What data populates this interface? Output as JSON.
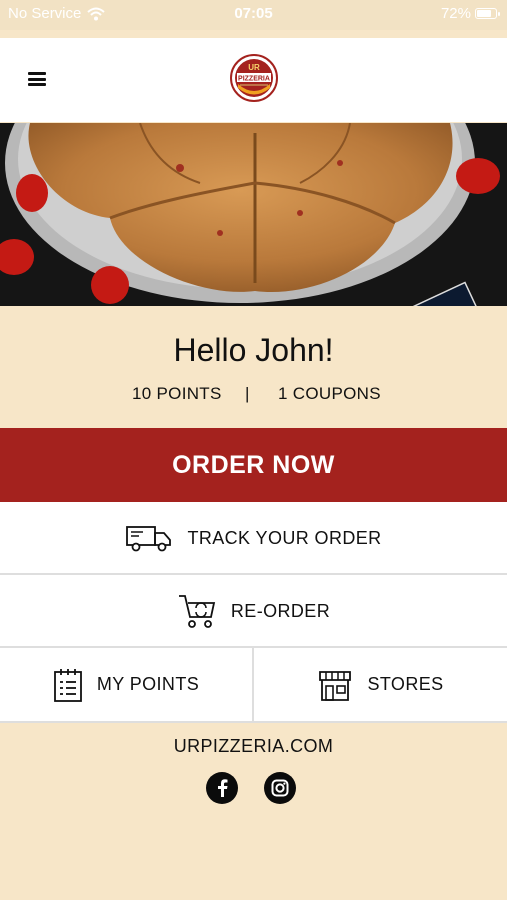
{
  "status_bar": {
    "carrier": "No Service",
    "time": "07:05",
    "battery": "72%"
  },
  "header": {
    "logo_text_top": "UR",
    "logo_text_main": "PIZZERIA"
  },
  "greeting": {
    "text": "Hello John!",
    "points": "10 POINTS",
    "separator": "|",
    "coupons": "1 COUPONS"
  },
  "actions": {
    "order_now": "ORDER NOW",
    "track_order": "TRACK YOUR ORDER",
    "reorder": "RE-ORDER",
    "my_points": "MY POINTS",
    "stores": "STORES"
  },
  "footer": {
    "website": "URPIZZERIA.COM"
  },
  "colors": {
    "accent_red": "#a4221e",
    "background_cream": "#f7e6c8",
    "card_white": "#ffffff"
  },
  "icons": [
    "wifi-icon",
    "battery-icon",
    "menu-icon",
    "truck-icon",
    "cart-icon",
    "notepad-icon",
    "store-icon",
    "facebook-icon",
    "instagram-icon"
  ]
}
